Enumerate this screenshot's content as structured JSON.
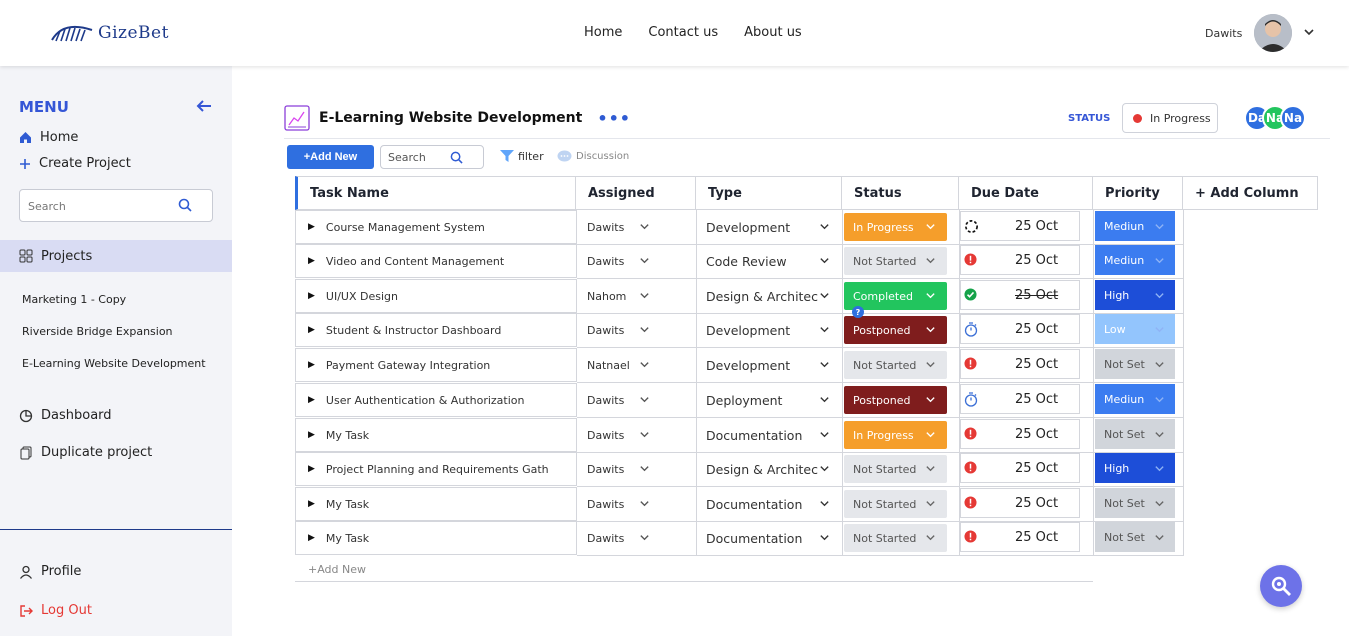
{
  "brand": {
    "name": "GizeBet"
  },
  "nav": {
    "items": [
      "Home",
      "Contact us",
      "About us"
    ]
  },
  "user": {
    "name": "Dawits"
  },
  "sidebar": {
    "menu_title": "MENU",
    "home": "Home",
    "create_project": "Create Project",
    "search_placeholder": "Search",
    "projects_label": "Projects",
    "project_list": [
      "Marketing 1 - Copy",
      "Riverside Bridge Expansion",
      "E-Learning Website Development"
    ],
    "dashboard": "Dashboard",
    "duplicate": "Duplicate project",
    "profile": "Profile",
    "logout": "Log Out"
  },
  "project": {
    "title": "E-Learning Website Development",
    "status_label": "STATUS",
    "status_value": "In Progress",
    "members": [
      {
        "initials": "Da",
        "color": "#2f6fe0"
      },
      {
        "initials": "Na",
        "color": "#22c55e"
      },
      {
        "initials": "Na",
        "color": "#2f6fe0"
      }
    ]
  },
  "toolbar": {
    "add_new": "+Add New",
    "search_placeholder": "Search",
    "filter": "filter",
    "discussion": "Discussion"
  },
  "columns": [
    "Task Name",
    "Assigned",
    "Type",
    "Status",
    "Due Date",
    "Priority",
    "+ Add Column"
  ],
  "rows": [
    {
      "task": "Course Management System",
      "assigned": "Dawits",
      "type": "Development",
      "status": "In Progress",
      "due": "25 Oct",
      "due_icon": "spinner-icon",
      "priority": "Mediun"
    },
    {
      "task": "Video and Content Management",
      "assigned": "Dawits",
      "type": "Code Review",
      "status": "Not Started",
      "due": "25 Oct",
      "due_icon": "alert-icon",
      "priority": "Mediun"
    },
    {
      "task": "UI/UX Design",
      "assigned": "Nahom",
      "type": "Design & Architec",
      "status": "Completed",
      "due": "25 Oct",
      "due_icon": "check-icon",
      "priority": "High"
    },
    {
      "task": "Student & Instructor Dashboard",
      "assigned": "Dawits",
      "type": "Development",
      "status": "Postponed",
      "due": "25 Oct",
      "due_icon": "timer-icon",
      "priority": "Low"
    },
    {
      "task": "Payment Gateway Integration",
      "assigned": "Natnael",
      "type": "Development",
      "status": "Not Started",
      "due": "25 Oct",
      "due_icon": "alert-icon",
      "priority": "Not Set"
    },
    {
      "task": "User Authentication & Authorization",
      "assigned": "Dawits",
      "type": "Deployment",
      "status": "Postponed",
      "due": "25 Oct",
      "due_icon": "timer-icon",
      "priority": "Mediun"
    },
    {
      "task": "My Task",
      "assigned": "Dawits",
      "type": "Documentation",
      "status": "In Progress",
      "due": "25 Oct",
      "due_icon": "alert-icon",
      "priority": "Not Set"
    },
    {
      "task": "Project Planning and Requirements Gath",
      "assigned": "Dawits",
      "type": "Design & Architec",
      "status": "Not Started",
      "due": "25 Oct",
      "due_icon": "alert-icon",
      "priority": "High"
    },
    {
      "task": "My Task",
      "assigned": "Dawits",
      "type": "Documentation",
      "status": "Not Started",
      "due": "25 Oct",
      "due_icon": "alert-icon",
      "priority": "Not Set"
    },
    {
      "task": "My Task",
      "assigned": "Dawits",
      "type": "Documentation",
      "status": "Not Started",
      "due": "25 Oct",
      "due_icon": "alert-icon",
      "priority": "Not Set"
    }
  ],
  "add_row": "+Add New",
  "colors": {
    "accent": "#2f6fe0",
    "status": {
      "In Progress": "#f59e2b",
      "Not Started": "#e5e7eb",
      "Completed": "#22c55e",
      "Postponed": "#7f1d1d"
    },
    "priority": {
      "Mediun": "#3b7cf0",
      "High": "#1d4ed8",
      "Low": "#93c5fd",
      "Not Set": "#d1d5db"
    }
  }
}
